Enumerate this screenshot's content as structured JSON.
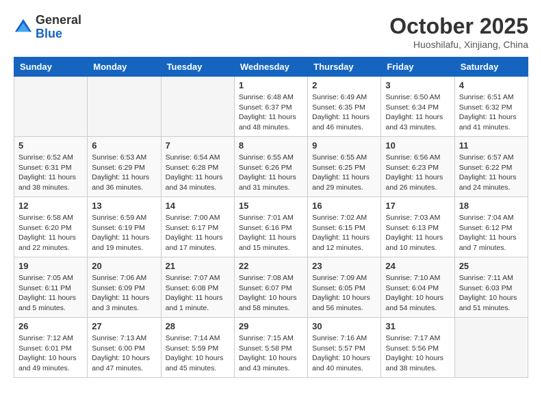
{
  "logo": {
    "general": "General",
    "blue": "Blue"
  },
  "header": {
    "month_title": "October 2025",
    "subtitle": "Huoshilafu, Xinjiang, China"
  },
  "days_of_week": [
    "Sunday",
    "Monday",
    "Tuesday",
    "Wednesday",
    "Thursday",
    "Friday",
    "Saturday"
  ],
  "weeks": [
    [
      {
        "day": "",
        "info": ""
      },
      {
        "day": "",
        "info": ""
      },
      {
        "day": "",
        "info": ""
      },
      {
        "day": "1",
        "info": "Sunrise: 6:48 AM\nSunset: 6:37 PM\nDaylight: 11 hours\nand 48 minutes."
      },
      {
        "day": "2",
        "info": "Sunrise: 6:49 AM\nSunset: 6:35 PM\nDaylight: 11 hours\nand 46 minutes."
      },
      {
        "day": "3",
        "info": "Sunrise: 6:50 AM\nSunset: 6:34 PM\nDaylight: 11 hours\nand 43 minutes."
      },
      {
        "day": "4",
        "info": "Sunrise: 6:51 AM\nSunset: 6:32 PM\nDaylight: 11 hours\nand 41 minutes."
      }
    ],
    [
      {
        "day": "5",
        "info": "Sunrise: 6:52 AM\nSunset: 6:31 PM\nDaylight: 11 hours\nand 38 minutes."
      },
      {
        "day": "6",
        "info": "Sunrise: 6:53 AM\nSunset: 6:29 PM\nDaylight: 11 hours\nand 36 minutes."
      },
      {
        "day": "7",
        "info": "Sunrise: 6:54 AM\nSunset: 6:28 PM\nDaylight: 11 hours\nand 34 minutes."
      },
      {
        "day": "8",
        "info": "Sunrise: 6:55 AM\nSunset: 6:26 PM\nDaylight: 11 hours\nand 31 minutes."
      },
      {
        "day": "9",
        "info": "Sunrise: 6:55 AM\nSunset: 6:25 PM\nDaylight: 11 hours\nand 29 minutes."
      },
      {
        "day": "10",
        "info": "Sunrise: 6:56 AM\nSunset: 6:23 PM\nDaylight: 11 hours\nand 26 minutes."
      },
      {
        "day": "11",
        "info": "Sunrise: 6:57 AM\nSunset: 6:22 PM\nDaylight: 11 hours\nand 24 minutes."
      }
    ],
    [
      {
        "day": "12",
        "info": "Sunrise: 6:58 AM\nSunset: 6:20 PM\nDaylight: 11 hours\nand 22 minutes."
      },
      {
        "day": "13",
        "info": "Sunrise: 6:59 AM\nSunset: 6:19 PM\nDaylight: 11 hours\nand 19 minutes."
      },
      {
        "day": "14",
        "info": "Sunrise: 7:00 AM\nSunset: 6:17 PM\nDaylight: 11 hours\nand 17 minutes."
      },
      {
        "day": "15",
        "info": "Sunrise: 7:01 AM\nSunset: 6:16 PM\nDaylight: 11 hours\nand 15 minutes."
      },
      {
        "day": "16",
        "info": "Sunrise: 7:02 AM\nSunset: 6:15 PM\nDaylight: 11 hours\nand 12 minutes."
      },
      {
        "day": "17",
        "info": "Sunrise: 7:03 AM\nSunset: 6:13 PM\nDaylight: 11 hours\nand 10 minutes."
      },
      {
        "day": "18",
        "info": "Sunrise: 7:04 AM\nSunset: 6:12 PM\nDaylight: 11 hours\nand 7 minutes."
      }
    ],
    [
      {
        "day": "19",
        "info": "Sunrise: 7:05 AM\nSunset: 6:11 PM\nDaylight: 11 hours\nand 5 minutes."
      },
      {
        "day": "20",
        "info": "Sunrise: 7:06 AM\nSunset: 6:09 PM\nDaylight: 11 hours\nand 3 minutes."
      },
      {
        "day": "21",
        "info": "Sunrise: 7:07 AM\nSunset: 6:08 PM\nDaylight: 11 hours\nand 1 minute."
      },
      {
        "day": "22",
        "info": "Sunrise: 7:08 AM\nSunset: 6:07 PM\nDaylight: 10 hours\nand 58 minutes."
      },
      {
        "day": "23",
        "info": "Sunrise: 7:09 AM\nSunset: 6:05 PM\nDaylight: 10 hours\nand 56 minutes."
      },
      {
        "day": "24",
        "info": "Sunrise: 7:10 AM\nSunset: 6:04 PM\nDaylight: 10 hours\nand 54 minutes."
      },
      {
        "day": "25",
        "info": "Sunrise: 7:11 AM\nSunset: 6:03 PM\nDaylight: 10 hours\nand 51 minutes."
      }
    ],
    [
      {
        "day": "26",
        "info": "Sunrise: 7:12 AM\nSunset: 6:01 PM\nDaylight: 10 hours\nand 49 minutes."
      },
      {
        "day": "27",
        "info": "Sunrise: 7:13 AM\nSunset: 6:00 PM\nDaylight: 10 hours\nand 47 minutes."
      },
      {
        "day": "28",
        "info": "Sunrise: 7:14 AM\nSunset: 5:59 PM\nDaylight: 10 hours\nand 45 minutes."
      },
      {
        "day": "29",
        "info": "Sunrise: 7:15 AM\nSunset: 5:58 PM\nDaylight: 10 hours\nand 43 minutes."
      },
      {
        "day": "30",
        "info": "Sunrise: 7:16 AM\nSunset: 5:57 PM\nDaylight: 10 hours\nand 40 minutes."
      },
      {
        "day": "31",
        "info": "Sunrise: 7:17 AM\nSunset: 5:56 PM\nDaylight: 10 hours\nand 38 minutes."
      },
      {
        "day": "",
        "info": ""
      }
    ]
  ]
}
